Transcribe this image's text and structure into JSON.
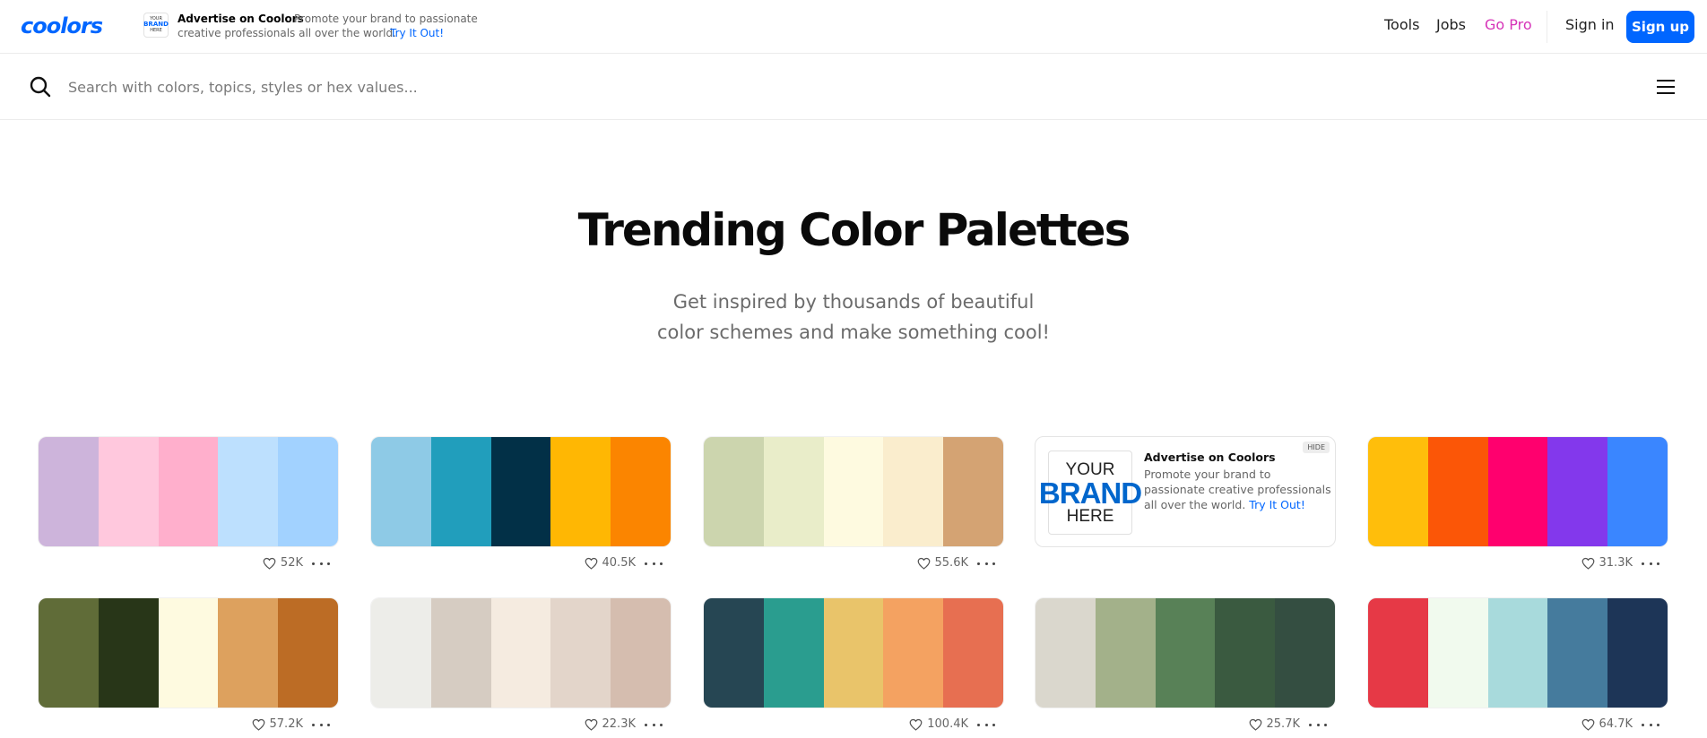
{
  "header": {
    "logo_text": "coolors",
    "ad": {
      "thumb_top": "YOUR",
      "thumb_mid": "BRAND",
      "thumb_bottom": "HERE",
      "title": "Advertise on Coolors",
      "desc_line1": "Promote your brand to passionate",
      "desc_line2": "creative professionals all over the world.",
      "link": "Try It Out!"
    },
    "nav": {
      "tools": "Tools",
      "jobs": "Jobs",
      "go_pro": "Go Pro",
      "sign_in": "Sign in",
      "sign_up": "Sign up"
    }
  },
  "search": {
    "placeholder": "Search with colors, topics, styles or hex values...",
    "value": ""
  },
  "hero": {
    "title": "Trending Color Palettes",
    "subtitle_line1": "Get inspired by thousands of beautiful",
    "subtitle_line2": "color schemes and make something cool!"
  },
  "palettes": [
    {
      "colors": [
        "#cdb4db",
        "#ffc8dd",
        "#ffafcc",
        "#bde0fe",
        "#a2d2ff"
      ],
      "likes": "52K"
    },
    {
      "colors": [
        "#8ecae6",
        "#219ebc",
        "#023047",
        "#ffb703",
        "#fb8500"
      ],
      "likes": "40.5K"
    },
    {
      "colors": [
        "#ccd5ae",
        "#e9edc9",
        "#fefae0",
        "#faedcd",
        "#d4a373"
      ],
      "likes": "55.6K"
    },
    {
      "colors": [
        "#ffbe0b",
        "#fb5607",
        "#ff006e",
        "#8338ec",
        "#3a86ff"
      ],
      "likes": "31.3K"
    },
    {
      "colors": [
        "#606c38",
        "#283618",
        "#fefae0",
        "#dda15e",
        "#bc6c25"
      ],
      "likes": "57.2K"
    },
    {
      "colors": [
        "#edede9",
        "#d6ccc2",
        "#f5ebe0",
        "#e3d5ca",
        "#d5bdaf"
      ],
      "likes": "22.3K"
    },
    {
      "colors": [
        "#264653",
        "#2a9d8f",
        "#e9c46a",
        "#f4a261",
        "#e76f51"
      ],
      "likes": "100.4K"
    },
    {
      "colors": [
        "#dad7cd",
        "#a3b18a",
        "#588157",
        "#3a5a40",
        "#344e41"
      ],
      "likes": "25.7K"
    },
    {
      "colors": [
        "#e63946",
        "#f1faee",
        "#a8dadc",
        "#457b9d",
        "#1d3557"
      ],
      "likes": "64.7K"
    }
  ],
  "ad_card": {
    "brand_top": "YOUR",
    "brand_mid": "BRAND",
    "brand_bottom": "HERE",
    "title": "Advertise on Coolors",
    "desc": "Promote your brand to passionate creative professionals all over the world.",
    "link": "Try It Out!",
    "hide": "HIDE"
  },
  "colors": {
    "accent": "#0066ff",
    "go_pro": "#d633b8"
  }
}
